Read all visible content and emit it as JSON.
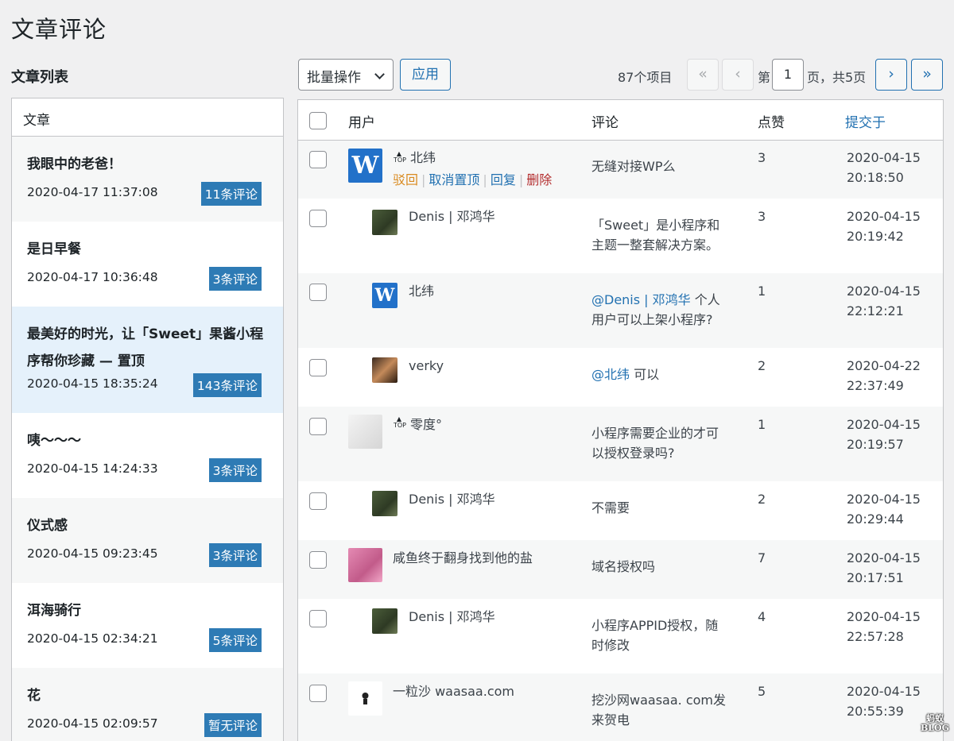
{
  "page": {
    "title": "文章评论",
    "list_title": "文章列表"
  },
  "posts": {
    "header": "文章",
    "items": [
      {
        "title": "我眼中的老爸！",
        "date": "2020-04-17 11:37:08",
        "badge": "11条评论"
      },
      {
        "title": "是日早餐",
        "date": "2020-04-17 10:36:48",
        "badge": "3条评论"
      },
      {
        "title": "最美好的时光，让「Sweet」果酱小程序帮你珍藏 — 置顶",
        "date": "2020-04-15 18:35:24",
        "badge": "143条评论"
      },
      {
        "title": "咦～～～",
        "date": "2020-04-15 14:24:33",
        "badge": "3条评论"
      },
      {
        "title": "仪式感",
        "date": "2020-04-15 09:23:45",
        "badge": "3条评论"
      },
      {
        "title": "洱海骑行",
        "date": "2020-04-15 02:34:21",
        "badge": "5条评论"
      },
      {
        "title": "花",
        "date": "2020-04-15 02:09:57",
        "badge": "暂无评论"
      }
    ]
  },
  "toolbar": {
    "bulk_label": "批量操作",
    "apply_label": "应用",
    "item_count": "87个项目",
    "first_label": "«",
    "prev_label": "‹",
    "page_prefix": "第",
    "current_page": "1",
    "page_suffix": "页，共5页",
    "next_label": "›",
    "last_label": "»"
  },
  "table": {
    "headers": {
      "user": "用户",
      "comment": "评论",
      "likes": "点赞",
      "submitted": "提交于"
    },
    "top_icon_label": "TOP",
    "actions": {
      "unapprove": "驳回",
      "untop": "取消置顶",
      "reply": "回复",
      "delete": "删除"
    },
    "rows": [
      {
        "user": "北纬",
        "comment_l1": "无缝对接WP么",
        "comment_l2": "",
        "mention": "",
        "likes": "3",
        "date": "2020-04-15",
        "time": "20:18:50"
      },
      {
        "user": "Denis | 邓鸿华",
        "comment_l1": "「Sweet」是小程序和",
        "comment_l2": "主题一整套解决方案。",
        "mention": "",
        "likes": "3",
        "date": "2020-04-15",
        "time": "20:19:42"
      },
      {
        "user": "北纬",
        "comment_l1": "个人",
        "comment_l2": "用户可以上架小程序?",
        "mention": "@Denis | 邓鸿华",
        "likes": "1",
        "date": "2020-04-15",
        "time": "22:12:21"
      },
      {
        "user": "verky",
        "comment_l1": "可以",
        "comment_l2": "",
        "mention": "@北纬",
        "likes": "2",
        "date": "2020-04-22",
        "time": "22:37:49"
      },
      {
        "user": "零度°",
        "comment_l1": "小程序需要企业的才可",
        "comment_l2": "以授权登录吗?",
        "mention": "",
        "likes": "1",
        "date": "2020-04-15",
        "time": "20:19:57"
      },
      {
        "user": "Denis | 邓鸿华",
        "comment_l1": "不需要",
        "comment_l2": "",
        "mention": "",
        "likes": "2",
        "date": "2020-04-15",
        "time": "20:29:44"
      },
      {
        "user": "咸鱼终于翻身找到他的盐",
        "comment_l1": "域名授权吗",
        "comment_l2": "",
        "mention": "",
        "likes": "7",
        "date": "2020-04-15",
        "time": "20:17:51"
      },
      {
        "user": "Denis | 邓鸿华",
        "comment_l1": "小程序APPID授权，随",
        "comment_l2": "时修改",
        "mention": "",
        "likes": "4",
        "date": "2020-04-15",
        "time": "22:57:28"
      },
      {
        "user": "一粒沙 waasaa.com",
        "comment_l1": "挖沙网waasaa. com发",
        "comment_l2": "来贺电",
        "mention": "",
        "likes": "5",
        "date": "2020-04-15",
        "time": "20:55:39"
      }
    ]
  },
  "watermark": {
    "line1": "蚂蚁",
    "line2": "BLOG"
  },
  "colors": {
    "accent": "#2271b1",
    "badge": "#2e7bb5",
    "unapprove": "#d98a1f",
    "delete": "#b32d2e"
  }
}
